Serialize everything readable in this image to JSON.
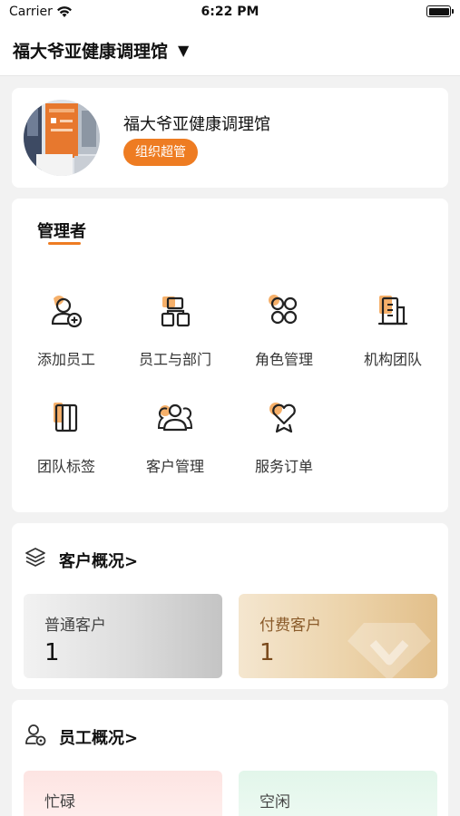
{
  "status_bar": {
    "carrier": "Carrier",
    "time": "6:22 PM"
  },
  "header": {
    "title": "福大爷亚健康调理馆",
    "caret": "▼"
  },
  "profile": {
    "name": "福大爷亚健康调理馆",
    "role": "组织超管"
  },
  "manager": {
    "title": "管理者",
    "items": [
      {
        "label": "添加员工",
        "icon": "add-user-icon"
      },
      {
        "label": "员工与部门",
        "icon": "org-chart-icon"
      },
      {
        "label": "角色管理",
        "icon": "grid-circles-icon"
      },
      {
        "label": "机构团队",
        "icon": "building-icon"
      },
      {
        "label": "团队标签",
        "icon": "tag-columns-icon"
      },
      {
        "label": "客户管理",
        "icon": "customers-icon"
      },
      {
        "label": "服务订单",
        "icon": "heart-badge-icon"
      }
    ]
  },
  "customers": {
    "title": "客户概况>",
    "normal": {
      "label": "普通客户",
      "value": "1"
    },
    "paid": {
      "label": "付费客户",
      "value": "1"
    }
  },
  "staff": {
    "title": "员工概况>",
    "busy": {
      "label": "忙碌"
    },
    "idle": {
      "label": "空闲"
    }
  },
  "colors": {
    "accent": "#ee7c22",
    "accent_light": "#f6b06a"
  }
}
